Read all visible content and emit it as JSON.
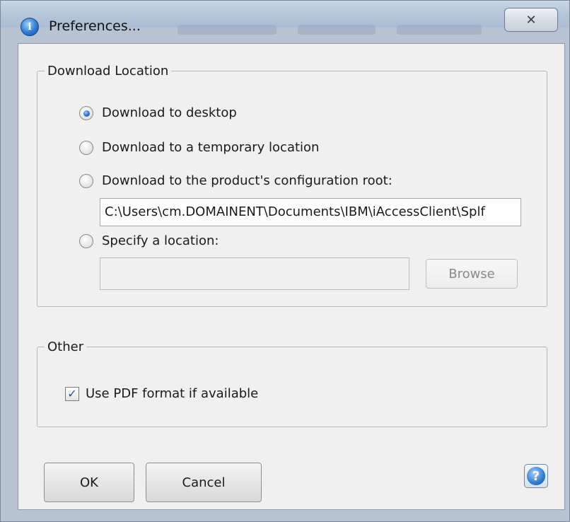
{
  "window": {
    "title": "Preferences...",
    "close_glyph": "✕"
  },
  "download_location": {
    "legend": "Download Location",
    "options": [
      {
        "label": "Download to desktop",
        "checked": true
      },
      {
        "label": "Download to a temporary location",
        "checked": false
      },
      {
        "label": "Download to the product's configuration root:",
        "checked": false
      },
      {
        "label": "Specify a location:",
        "checked": false
      }
    ],
    "config_root_path": "C:\\Users\\cm.DOMAINENT\\Documents\\IBM\\iAccessClient\\Splf",
    "specify_path": "",
    "browse_label": "Browse"
  },
  "other": {
    "legend": "Other",
    "pdf_label": "Use PDF format if available",
    "pdf_checked": true
  },
  "footer": {
    "ok_label": "OK",
    "cancel_label": "Cancel",
    "help_glyph": "?"
  },
  "icons": {
    "app": "info-icon",
    "close": "close-icon",
    "help": "help-icon",
    "check": "checkmark-icon"
  },
  "colors": {
    "titlebar": "#b3c5d9",
    "client": "#f0f0f0",
    "accent": "#2f7bd1"
  }
}
